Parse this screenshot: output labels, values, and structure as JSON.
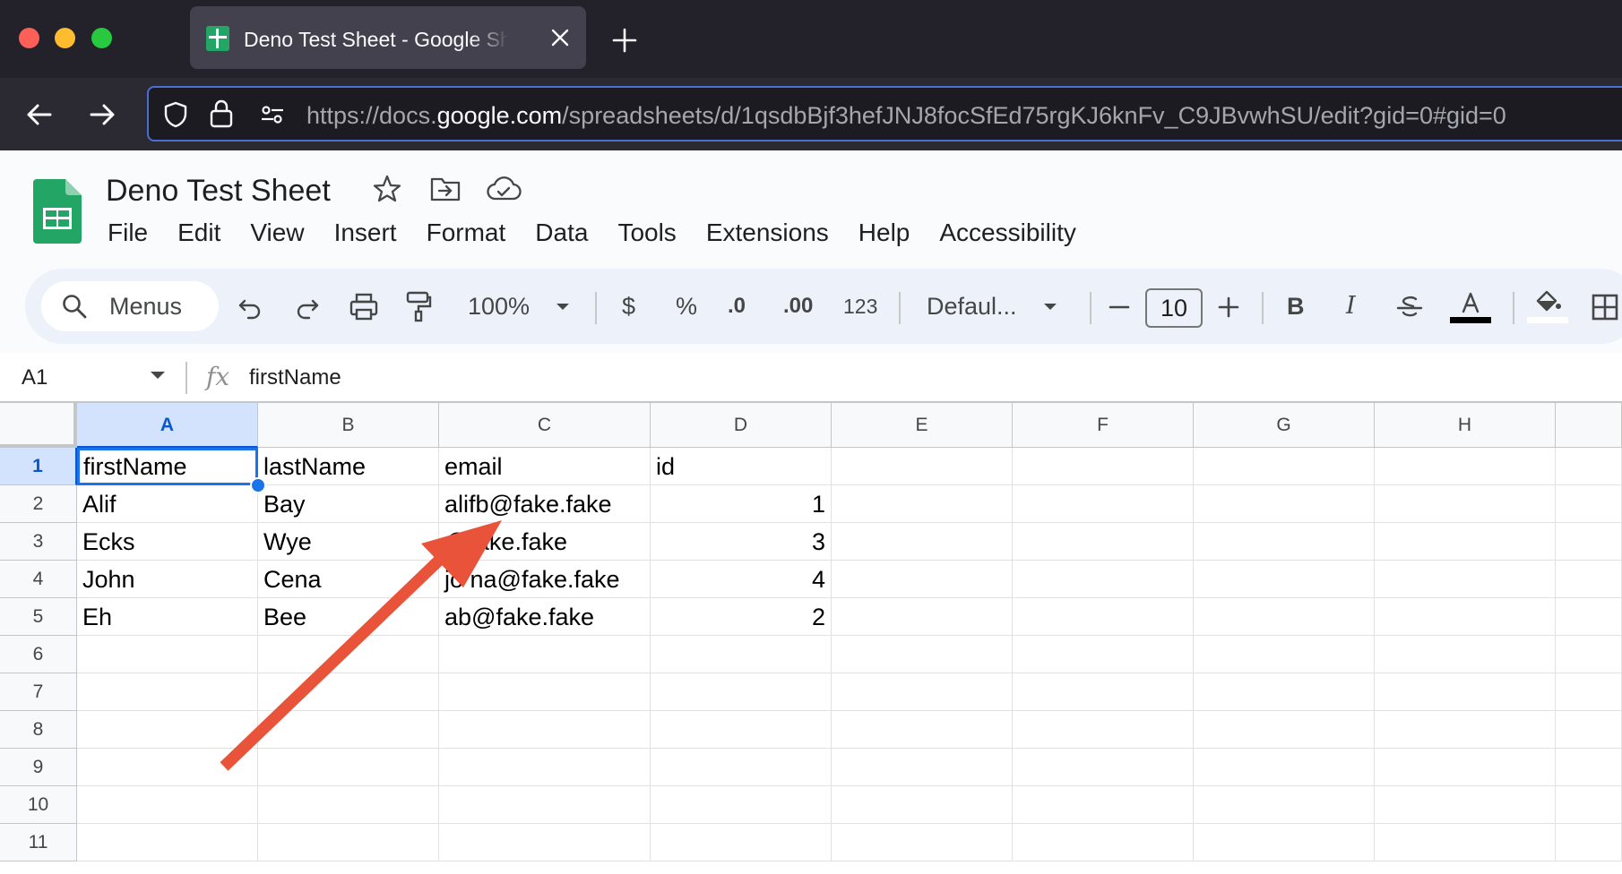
{
  "browser": {
    "tab_title": "Deno Test Sheet - Google Sheets",
    "url_prefix": "https://docs.",
    "url_host": "google.com",
    "url_path": "/spreadsheets/d/1qsdbBjf3hefJNJ8focSfEd75rgKJ6knFv_C9JBvwhSU/edit?gid=0#gid=0"
  },
  "sheets": {
    "doc_title": "Deno Test Sheet",
    "menu": [
      "File",
      "Edit",
      "View",
      "Insert",
      "Format",
      "Data",
      "Tools",
      "Extensions",
      "Help",
      "Accessibility"
    ]
  },
  "toolbar": {
    "menus_label": "Menus",
    "zoom": "100%",
    "currency": "$",
    "percent": "%",
    "decrease_decimals": ".0",
    "increase_decimals": ".00",
    "more_formats": "123",
    "font": "Defaul...",
    "font_size": "10",
    "bold": "B",
    "italic": "I",
    "text_color_letter": "A"
  },
  "formula_bar": {
    "cell_ref": "A1",
    "fx": "fx",
    "value": "firstName"
  },
  "grid": {
    "columns": [
      "A",
      "B",
      "C",
      "D",
      "E",
      "F",
      "G",
      "H"
    ],
    "row_numbers": [
      "1",
      "2",
      "3",
      "4",
      "5",
      "6",
      "7",
      "8",
      "9",
      "10",
      "11"
    ],
    "rows": [
      [
        "firstName",
        "lastName",
        "email",
        "id"
      ],
      [
        "Alif",
        "Bay",
        "alifb@fake.fake",
        "1"
      ],
      [
        "Ecks",
        "Wye",
        "@fake.fake",
        "3"
      ],
      [
        "John",
        "Cena",
        "jo na@fake.fake",
        "4"
      ],
      [
        "Eh",
        "Bee",
        "ab@fake.fake",
        "2"
      ]
    ],
    "selected_cell": "A1"
  },
  "colors": {
    "annotation_arrow": "#e8533a",
    "selection": "#1a73e8",
    "sheets_green": "#23a566"
  }
}
